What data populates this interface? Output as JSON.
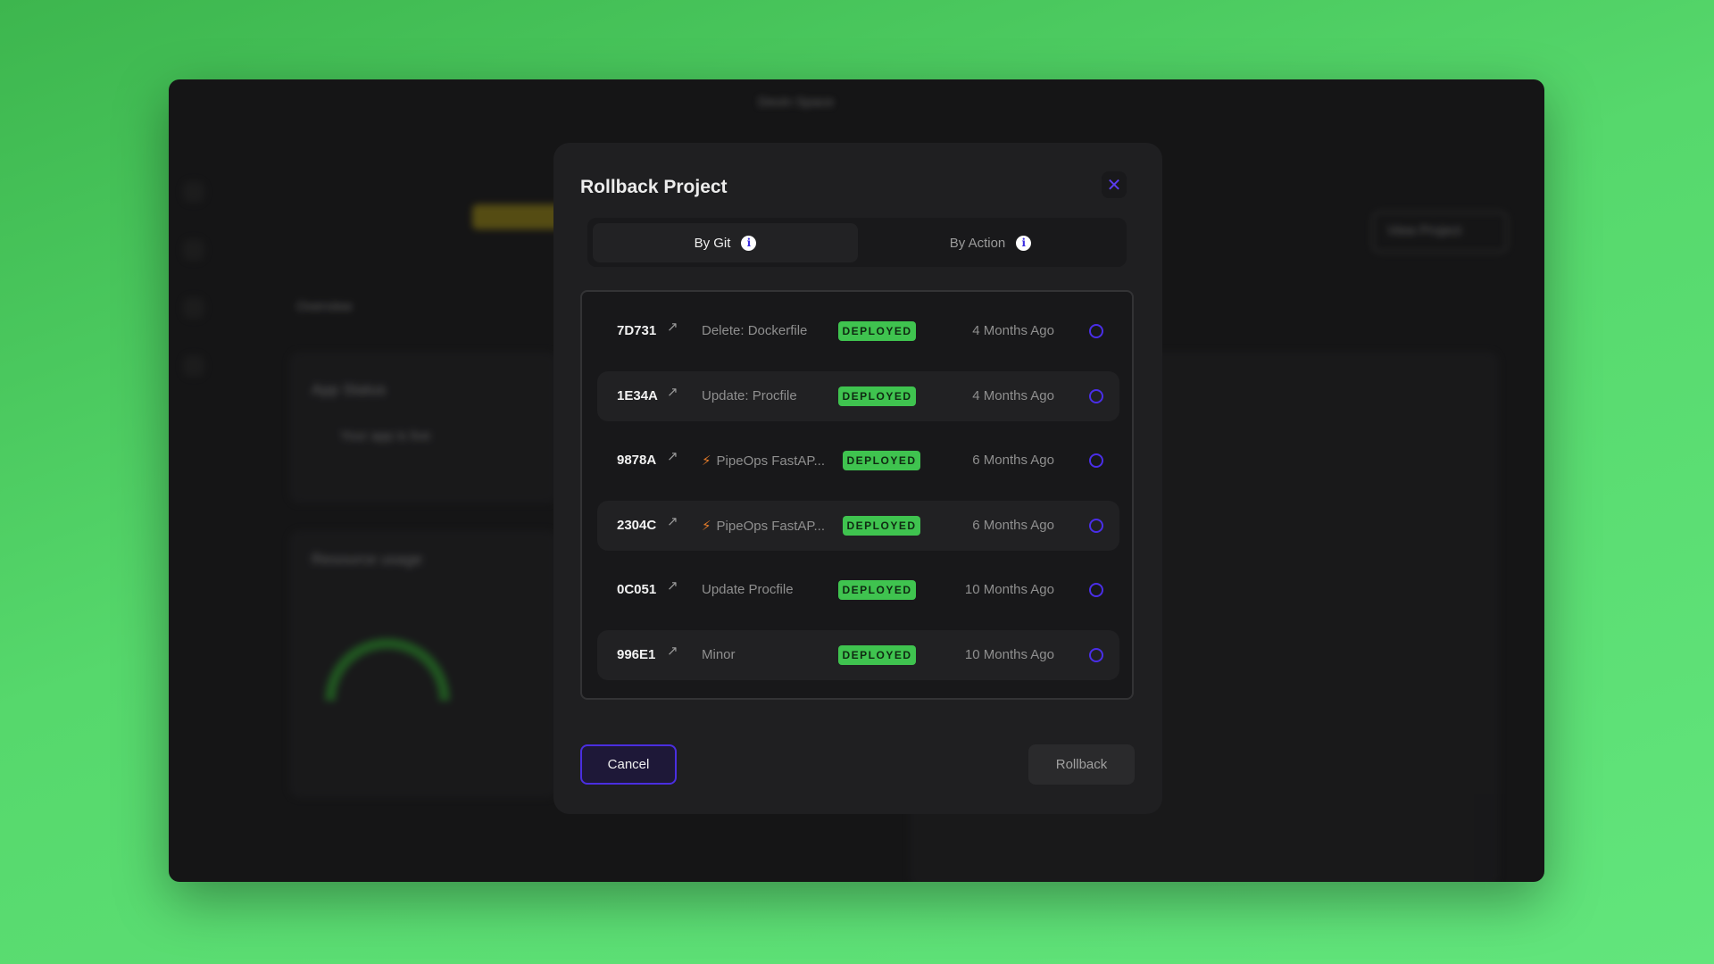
{
  "background": {
    "workspace": "Devin Space",
    "tabs": [
      "Overview"
    ],
    "sections": [
      "App Status",
      "Resource usage"
    ],
    "status_text": "Your app is live",
    "view_project": "View Project"
  },
  "modal": {
    "title": "Rollback Project",
    "close_icon": "close-icon",
    "tabs": [
      {
        "label": "By Git",
        "active": true
      },
      {
        "label": "By Action",
        "active": false
      }
    ],
    "commits": [
      {
        "hash": "7D731",
        "message": "Delete: Dockerfile",
        "bolt": false,
        "status": "DEPLOYED",
        "time": "4 Months Ago",
        "selected": false
      },
      {
        "hash": "1E34A",
        "message": "Update: Procfile",
        "bolt": false,
        "status": "DEPLOYED",
        "time": "4 Months Ago",
        "selected": false
      },
      {
        "hash": "9878A",
        "message": "PipeOps FastAP...",
        "bolt": true,
        "status": "DEPLOYED",
        "time": "6 Months Ago",
        "selected": false
      },
      {
        "hash": "2304C",
        "message": "PipeOps FastAP...",
        "bolt": true,
        "status": "DEPLOYED",
        "time": "6 Months Ago",
        "selected": false
      },
      {
        "hash": "0C051",
        "message": "Update Procfile",
        "bolt": false,
        "status": "DEPLOYED",
        "time": "10 Months Ago",
        "selected": false
      },
      {
        "hash": "996E1",
        "message": "Minor",
        "bolt": false,
        "status": "DEPLOYED",
        "time": "10 Months Ago",
        "selected": false
      }
    ],
    "cancel_label": "Cancel",
    "rollback_label": "Rollback"
  },
  "colors": {
    "accent": "#4a2ee8",
    "deployed": "#3fc34f",
    "bolt": "#e07a2a"
  }
}
